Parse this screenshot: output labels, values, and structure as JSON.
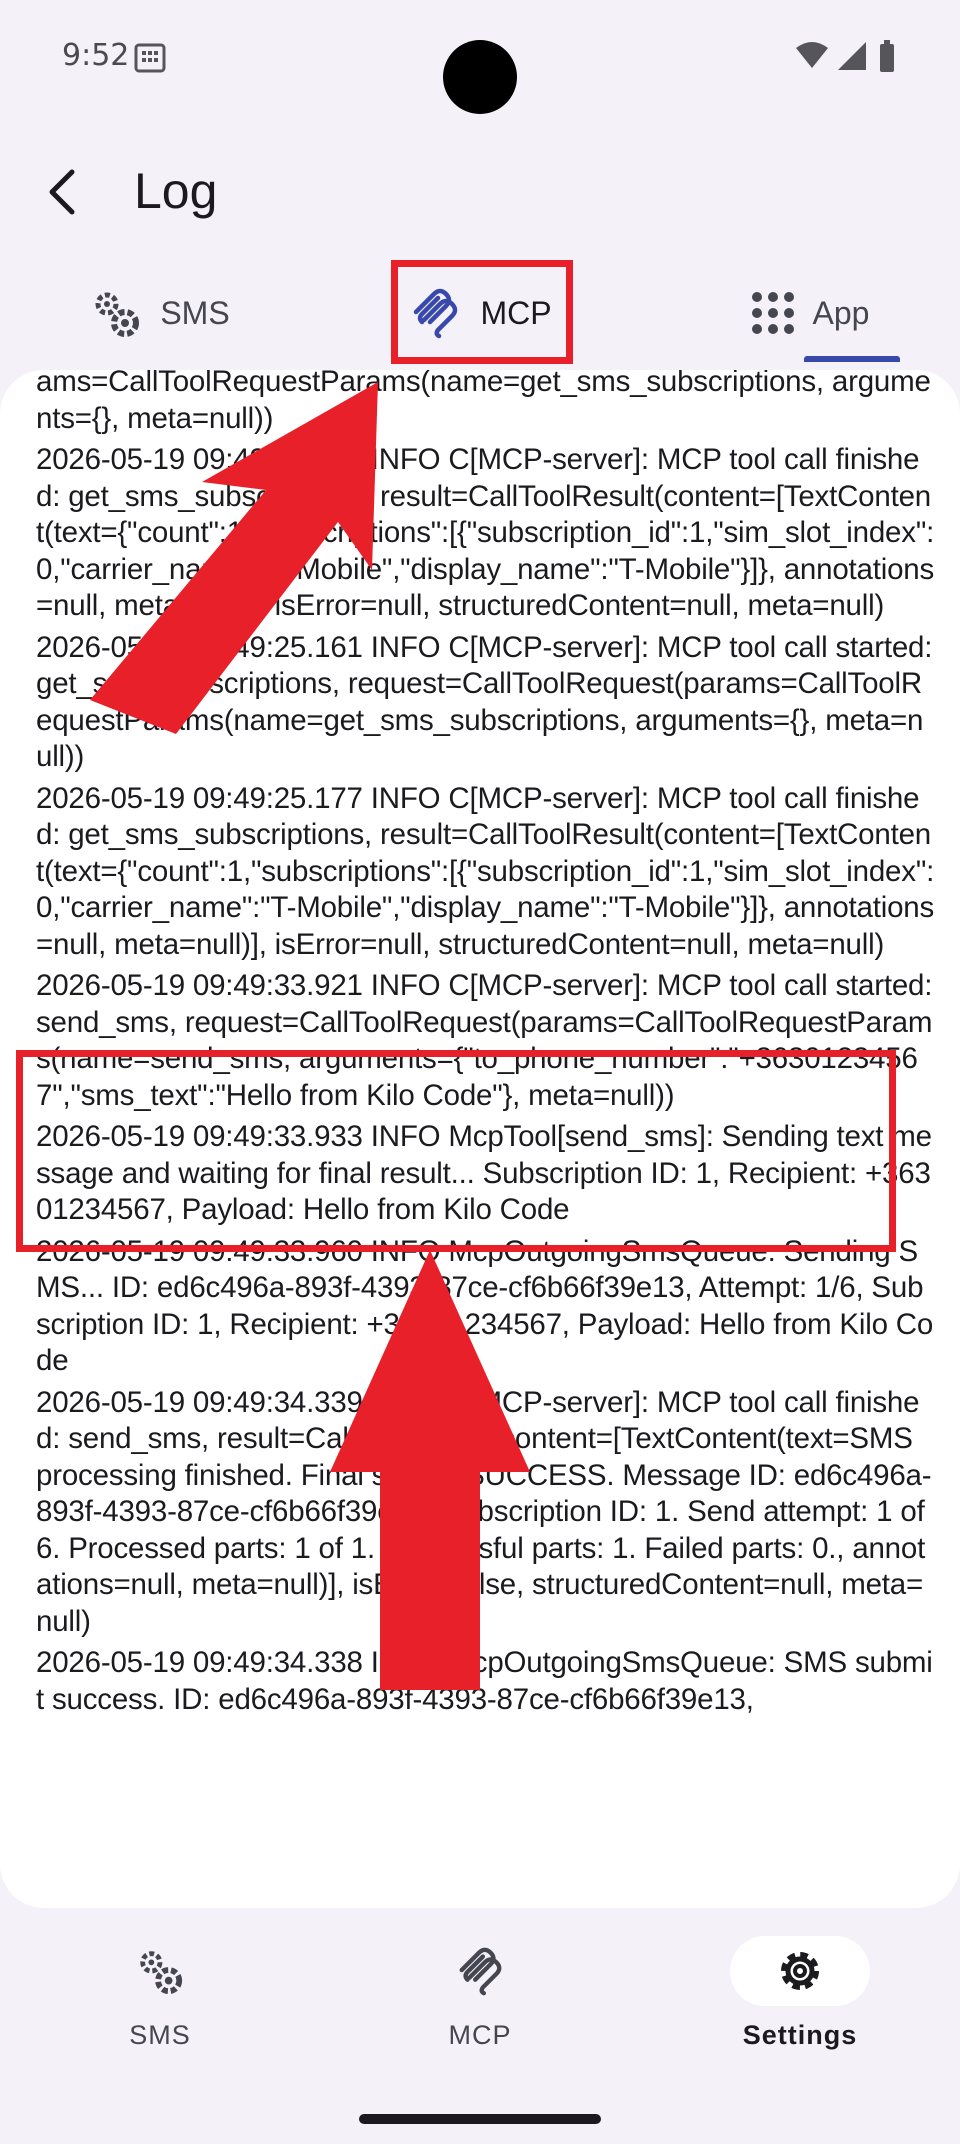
{
  "status_bar": {
    "time": "9:52"
  },
  "app_bar": {
    "title": "Log"
  },
  "tabs": [
    {
      "label": "SMS",
      "icon": "gears-icon"
    },
    {
      "label": "MCP",
      "icon": "mcp-icon",
      "selected": true
    },
    {
      "label": "App",
      "icon": "grid-icon"
    }
  ],
  "log_lines": [
    "ams=CallToolRequestParams(name=get_sms_subscriptions, arguments={}, meta=null))",
    "2026-05-19 09:49:25.161 INFO C[MCP-server]: MCP tool call finished: get_sms_subscriptions, result=CallToolResult(content=[TextContent(text={\"count\":1,\"subscriptions\":[{\"subscription_id\":1,\"sim_slot_index\":0,\"carrier_name\":\"T-Mobile\",\"display_name\":\"T-Mobile\"}]}, annotations=null, meta=null)], isError=null, structuredContent=null, meta=null)",
    "2026-05-19 09:49:25.161 INFO C[MCP-server]: MCP tool call started: get_sms_subscriptions, request=CallToolRequest(params=CallToolRequestParams(name=get_sms_subscriptions, arguments={}, meta=null))",
    "2026-05-19 09:49:25.177 INFO C[MCP-server]: MCP tool call finished: get_sms_subscriptions, result=CallToolResult(content=[TextContent(text={\"count\":1,\"subscriptions\":[{\"subscription_id\":1,\"sim_slot_index\":0,\"carrier_name\":\"T-Mobile\",\"display_name\":\"T-Mobile\"}]}, annotations=null, meta=null)], isError=null, structuredContent=null, meta=null)",
    "2026-05-19 09:49:33.921 INFO C[MCP-server]: MCP tool call started: send_sms, request=CallToolRequest(params=CallToolRequestParams(name=send_sms, arguments={\"to_phone_number\":\"+36301234567\",\"sms_text\":\"Hello from Kilo Code\"}, meta=null))",
    "2026-05-19 09:49:33.933 INFO McpTool[send_sms]: Sending text message and waiting for final result... Subscription ID: 1, Recipient: +36301234567, Payload: Hello from Kilo Code",
    "2026-05-19 09:49:33.960 INFO McpOutgoingSmsQueue: Sending SMS... ID: ed6c496a-893f-4393-87ce-cf6b66f39e13, Attempt: 1/6, Subscription ID: 1, Recipient: +36301234567, Payload: Hello from Kilo Code",
    "2026-05-19 09:49:34.339 INFO C[MCP-server]: MCP tool call finished: send_sms, result=CallToolResult(content=[TextContent(text=SMS processing finished. Final status: SUCCESS. Message ID: ed6c496a-893f-4393-87ce-cf6b66f39e13. Subscription ID: 1. Send attempt: 1 of 6. Processed parts: 1 of 1. Successful parts: 1. Failed parts: 0., annotations=null, meta=null)], isError=false, structuredContent=null, meta=null)",
    "2026-05-19 09:49:34.338 INFO McpOutgoingSmsQueue: SMS submit success. ID: ed6c496a-893f-4393-87ce-cf6b66f39e13,"
  ],
  "bottom_nav": [
    {
      "label": "SMS",
      "icon": "gears-icon"
    },
    {
      "label": "MCP",
      "icon": "mcp-icon"
    },
    {
      "label": "Settings",
      "icon": "settings-gear-icon",
      "selected": true
    }
  ],
  "colors": {
    "highlight": "#e8202a",
    "accent": "#3949ab",
    "background": "#f4f1f9",
    "card": "#ffffff"
  }
}
